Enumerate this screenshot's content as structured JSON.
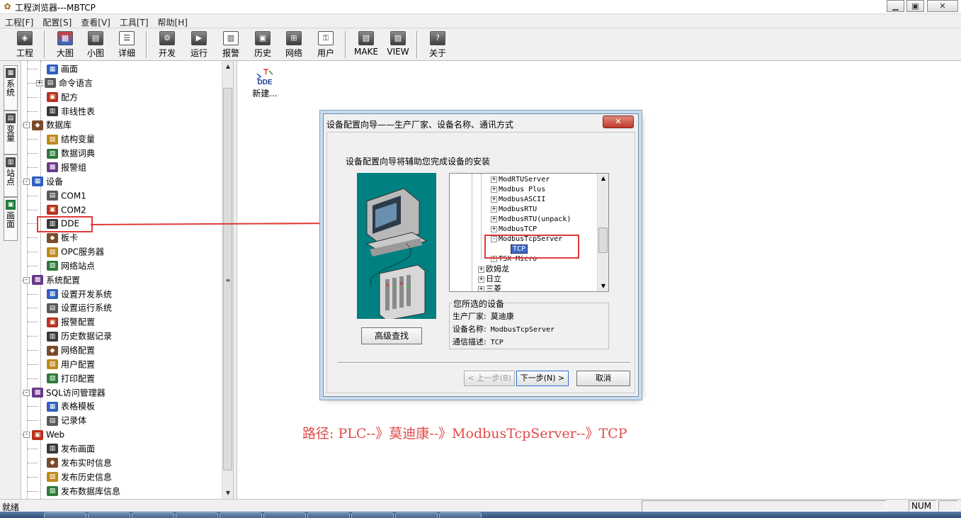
{
  "window": {
    "title": "工程浏览器---MBTCP"
  },
  "menu": [
    "工程[F]",
    "配置[S]",
    "查看[V]",
    "工具[T]",
    "帮助[H]"
  ],
  "toolbar": [
    {
      "label": "工程",
      "icon": "project-icon"
    },
    {
      "label": "大图",
      "icon": "large-icons-icon"
    },
    {
      "label": "小图",
      "icon": "small-icons-icon"
    },
    {
      "label": "详细",
      "icon": "details-icon"
    },
    {
      "label": "开发",
      "icon": "develop-icon"
    },
    {
      "label": "运行",
      "icon": "run-icon"
    },
    {
      "label": "报警",
      "icon": "alarm-icon"
    },
    {
      "label": "历史",
      "icon": "history-icon"
    },
    {
      "label": "网络",
      "icon": "network-icon"
    },
    {
      "label": "用户",
      "icon": "user-key-icon"
    },
    {
      "label": "MAKE",
      "icon": "make-icon"
    },
    {
      "label": "VIEW",
      "icon": "view-icon"
    },
    {
      "label": "关于",
      "icon": "about-icon"
    }
  ],
  "side_tabs": [
    "系统",
    "变量",
    "站点",
    "画面"
  ],
  "tree": [
    {
      "label": "画面",
      "level": 2
    },
    {
      "label": "命令语言",
      "level": 2,
      "expander": "+"
    },
    {
      "label": "配方",
      "level": 2
    },
    {
      "label": "非线性表",
      "level": 2
    },
    {
      "label": "数据库",
      "level": 1,
      "expander": "-"
    },
    {
      "label": "结构变量",
      "level": 2
    },
    {
      "label": "数据词典",
      "level": 2
    },
    {
      "label": "报警组",
      "level": 2
    },
    {
      "label": "设备",
      "level": 1,
      "expander": "-"
    },
    {
      "label": "COM1",
      "level": 2
    },
    {
      "label": "COM2",
      "level": 2
    },
    {
      "label": "DDE",
      "level": 2,
      "highlighted": true
    },
    {
      "label": "板卡",
      "level": 2
    },
    {
      "label": "OPC服务器",
      "level": 2
    },
    {
      "label": "网络站点",
      "level": 2
    },
    {
      "label": "系统配置",
      "level": 1,
      "expander": "-"
    },
    {
      "label": "设置开发系统",
      "level": 2
    },
    {
      "label": "设置运行系统",
      "level": 2
    },
    {
      "label": "报警配置",
      "level": 2
    },
    {
      "label": "历史数据记录",
      "level": 2
    },
    {
      "label": "网络配置",
      "level": 2
    },
    {
      "label": "用户配置",
      "level": 2
    },
    {
      "label": "打印配置",
      "level": 2
    },
    {
      "label": "SQL访问管理器",
      "level": 1,
      "expander": "-"
    },
    {
      "label": "表格模板",
      "level": 2
    },
    {
      "label": "记录体",
      "level": 2
    },
    {
      "label": "Web",
      "level": 1,
      "expander": "-"
    },
    {
      "label": "发布画面",
      "level": 2
    },
    {
      "label": "发布实时信息",
      "level": 2
    },
    {
      "label": "发布历史信息",
      "level": 2
    },
    {
      "label": "发布数据库信息",
      "level": 2
    }
  ],
  "content": {
    "dde_icon_text": "DDE",
    "new_item_label": "新建..."
  },
  "dialog": {
    "title": "设备配置向导——生产厂家、设备名称、通讯方式",
    "close_glyph": "✕",
    "intro": "设备配置向导将辅助您完成设备的安装",
    "advanced_button": "高级查找",
    "device_tree": [
      {
        "label": "ModRTUServer",
        "expander": "+",
        "level": 2
      },
      {
        "label": "Modbus Plus",
        "expander": "+",
        "level": 2
      },
      {
        "label": "ModbusASCII",
        "expander": "+",
        "level": 2
      },
      {
        "label": "ModbusRTU",
        "expander": "+",
        "level": 2
      },
      {
        "label": "ModbusRTU(unpack)",
        "expander": "+",
        "level": 2
      },
      {
        "label": "ModbusTCP",
        "expander": "+",
        "level": 2
      },
      {
        "label": "ModbusTcpServer",
        "expander": "-",
        "level": 2
      },
      {
        "label": "TCP",
        "level": 3,
        "selected": true
      },
      {
        "label": "TSX Micro",
        "expander": "+",
        "level": 2
      },
      {
        "label": "欧姆龙",
        "expander": "+",
        "level": 1
      },
      {
        "label": "日立",
        "expander": "+",
        "level": 1
      },
      {
        "label": "三菱",
        "expander": "+",
        "level": 1
      }
    ],
    "selected_group_label": "您所选的设备",
    "manufacturer_label": "生产厂家:",
    "manufacturer_value": "莫迪康",
    "device_name_label": "设备名称:",
    "device_name_value": "ModbusTcpServer",
    "comm_label": "通信描述:",
    "comm_value": "TCP",
    "prev_button": "< 上一步(B)",
    "next_button": "下一步(N) >",
    "cancel_button": "取消"
  },
  "annotation": {
    "path_text": "路径: PLC--》莫迪康--》ModbusTcpServer--》TCP",
    "color": "#e24848"
  },
  "status": {
    "text": "就绪",
    "num": "NUM"
  }
}
